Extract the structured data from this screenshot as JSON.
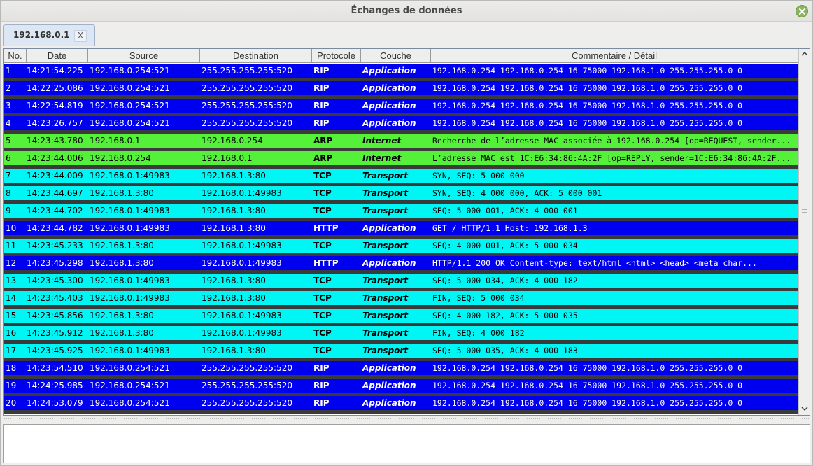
{
  "window": {
    "title": "Échanges de données"
  },
  "tab": {
    "label": "192.168.0.1",
    "close_label": "X"
  },
  "columns": [
    "No.",
    "Date",
    "Source",
    "Destination",
    "Protocole",
    "Couche",
    "Commentaire / Détail"
  ],
  "colors": {
    "application": "#0000f0",
    "internet": "#55f03a",
    "transport": "#00f5f5",
    "separator": "#3a3a3a"
  },
  "rows": [
    {
      "no": "1",
      "date": "14:21:54.225",
      "source": "192.168.0.254:521",
      "destination": "255.255.255.255:520",
      "protocol": "RIP",
      "layer": "Application",
      "comment": "192.168.0.254 192.168.0.254 16 75000 192.168.1.0 255.255.255.0 0"
    },
    {
      "no": "2",
      "date": "14:22:25.086",
      "source": "192.168.0.254:521",
      "destination": "255.255.255.255:520",
      "protocol": "RIP",
      "layer": "Application",
      "comment": "192.168.0.254 192.168.0.254 16 75000 192.168.1.0 255.255.255.0 0"
    },
    {
      "no": "3",
      "date": "14:22:54.819",
      "source": "192.168.0.254:521",
      "destination": "255.255.255.255:520",
      "protocol": "RIP",
      "layer": "Application",
      "comment": "192.168.0.254 192.168.0.254 16 75000 192.168.1.0 255.255.255.0 0"
    },
    {
      "no": "4",
      "date": "14:23:26.757",
      "source": "192.168.0.254:521",
      "destination": "255.255.255.255:520",
      "protocol": "RIP",
      "layer": "Application",
      "comment": "192.168.0.254 192.168.0.254 16 75000 192.168.1.0 255.255.255.0 0"
    },
    {
      "no": "5",
      "date": "14:23:43.780",
      "source": "192.168.0.1",
      "destination": "192.168.0.254",
      "protocol": "ARP",
      "layer": "Internet",
      "comment": "Recherche de l’adresse MAC associée à 192.168.0.254 [op=REQUEST, sender..."
    },
    {
      "no": "6",
      "date": "14:23:44.006",
      "source": "192.168.0.254",
      "destination": "192.168.0.1",
      "protocol": "ARP",
      "layer": "Internet",
      "comment": "L’adresse MAC est 1C:E6:34:86:4A:2F [op=REPLY, sender=1C:E6:34:86:4A:2F..."
    },
    {
      "no": "7",
      "date": "14:23:44.009",
      "source": "192.168.0.1:49983",
      "destination": "192.168.1.3:80",
      "protocol": "TCP",
      "layer": "Transport",
      "comment": "SYN, SEQ: 5 000 000"
    },
    {
      "no": "8",
      "date": "14:23:44.697",
      "source": "192.168.1.3:80",
      "destination": "192.168.0.1:49983",
      "protocol": "TCP",
      "layer": "Transport",
      "comment": "SYN, SEQ: 4 000 000, ACK: 5 000 001"
    },
    {
      "no": "9",
      "date": "14:23:44.702",
      "source": "192.168.0.1:49983",
      "destination": "192.168.1.3:80",
      "protocol": "TCP",
      "layer": "Transport",
      "comment": "SEQ: 5 000 001, ACK: 4 000 001"
    },
    {
      "no": "10",
      "date": "14:23:44.782",
      "source": "192.168.0.1:49983",
      "destination": "192.168.1.3:80",
      "protocol": "HTTP",
      "layer": "Application",
      "comment": "GET / HTTP/1.1 Host: 192.168.1.3"
    },
    {
      "no": "11",
      "date": "14:23:45.233",
      "source": "192.168.1.3:80",
      "destination": "192.168.0.1:49983",
      "protocol": "TCP",
      "layer": "Transport",
      "comment": "SEQ: 4 000 001, ACK: 5 000 034"
    },
    {
      "no": "12",
      "date": "14:23:45.298",
      "source": "192.168.1.3:80",
      "destination": "192.168.0.1:49983",
      "protocol": "HTTP",
      "layer": "Application",
      "comment": "HTTP/1.1 200 OK Content-type: text/html  <html>   <head>    <meta char..."
    },
    {
      "no": "13",
      "date": "14:23:45.300",
      "source": "192.168.0.1:49983",
      "destination": "192.168.1.3:80",
      "protocol": "TCP",
      "layer": "Transport",
      "comment": "SEQ: 5 000 034, ACK: 4 000 182"
    },
    {
      "no": "14",
      "date": "14:23:45.403",
      "source": "192.168.0.1:49983",
      "destination": "192.168.1.3:80",
      "protocol": "TCP",
      "layer": "Transport",
      "comment": "FIN, SEQ: 5 000 034"
    },
    {
      "no": "15",
      "date": "14:23:45.856",
      "source": "192.168.1.3:80",
      "destination": "192.168.0.1:49983",
      "protocol": "TCP",
      "layer": "Transport",
      "comment": "SEQ: 4 000 182, ACK: 5 000 035"
    },
    {
      "no": "16",
      "date": "14:23:45.912",
      "source": "192.168.1.3:80",
      "destination": "192.168.0.1:49983",
      "protocol": "TCP",
      "layer": "Transport",
      "comment": "FIN, SEQ: 4 000 182"
    },
    {
      "no": "17",
      "date": "14:23:45.925",
      "source": "192.168.0.1:49983",
      "destination": "192.168.1.3:80",
      "protocol": "TCP",
      "layer": "Transport",
      "comment": "SEQ: 5 000 035, ACK: 4 000 183"
    },
    {
      "no": "18",
      "date": "14:23:54.510",
      "source": "192.168.0.254:521",
      "destination": "255.255.255.255:520",
      "protocol": "RIP",
      "layer": "Application",
      "comment": "192.168.0.254 192.168.0.254 16 75000 192.168.1.0 255.255.255.0 0"
    },
    {
      "no": "19",
      "date": "14:24:25.985",
      "source": "192.168.0.254:521",
      "destination": "255.255.255.255:520",
      "protocol": "RIP",
      "layer": "Application",
      "comment": "192.168.0.254 192.168.0.254 16 75000 192.168.1.0 255.255.255.0 0"
    },
    {
      "no": "20",
      "date": "14:24:53.079",
      "source": "192.168.0.254:521",
      "destination": "255.255.255.255:520",
      "protocol": "RIP",
      "layer": "Application",
      "comment": "192.168.0.254 192.168.0.254 16 75000 192.168.1.0 255.255.255.0 0"
    }
  ]
}
